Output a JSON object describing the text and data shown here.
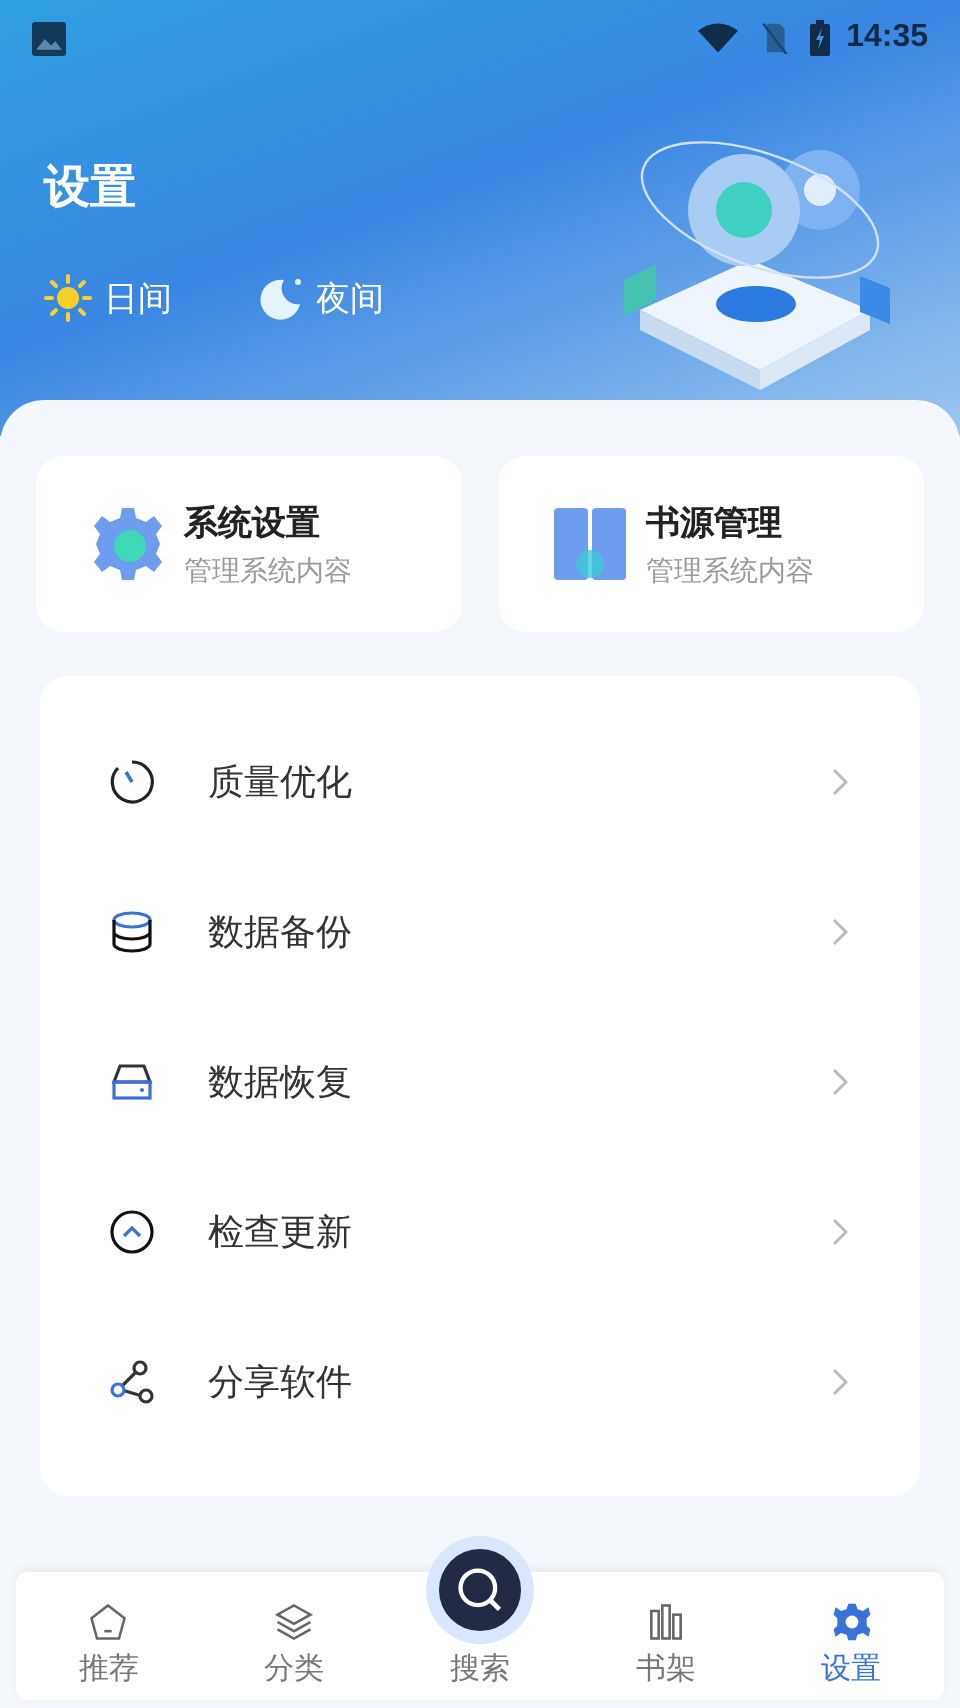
{
  "status_bar": {
    "time": "14:35"
  },
  "header": {
    "title": "设置",
    "modes": [
      {
        "kind": "day",
        "label": "日间"
      },
      {
        "kind": "night",
        "label": "夜间"
      }
    ]
  },
  "shortcuts": [
    {
      "kind": "gear",
      "title": "系统设置",
      "subtitle": "管理系统内容"
    },
    {
      "kind": "book",
      "title": "书源管理",
      "subtitle": "管理系统内容"
    }
  ],
  "menu": [
    {
      "kind": "timer",
      "label": "质量优化"
    },
    {
      "kind": "database",
      "label": "数据备份"
    },
    {
      "kind": "drive",
      "label": "数据恢复"
    },
    {
      "kind": "update",
      "label": "检查更新"
    },
    {
      "kind": "share",
      "label": "分享软件"
    }
  ],
  "bottom_nav": [
    {
      "kind": "home",
      "label": "推荐",
      "selected": false
    },
    {
      "kind": "layers",
      "label": "分类",
      "selected": false
    },
    {
      "kind": "search",
      "label": "搜索",
      "selected": false
    },
    {
      "kind": "shelf",
      "label": "书架",
      "selected": false
    },
    {
      "kind": "settings",
      "label": "设置",
      "selected": true
    }
  ]
}
